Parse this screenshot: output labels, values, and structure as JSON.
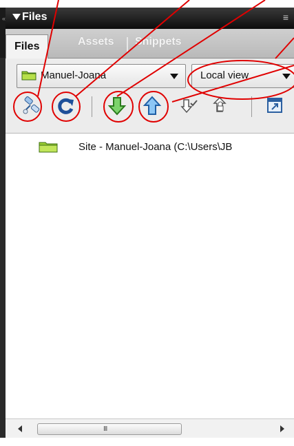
{
  "panel": {
    "title": "Files",
    "collapse_glyph": "«",
    "options_glyph": "≡"
  },
  "tabs": [
    {
      "label": "Files",
      "active": true
    },
    {
      "label": "Assets",
      "active": false
    },
    {
      "label": "Snippets",
      "active": false
    }
  ],
  "toolbar": {
    "site_select": {
      "value": "Manuel-Joana"
    },
    "view_select": {
      "value": "Local view"
    },
    "buttons": [
      {
        "name": "connect-icon"
      },
      {
        "name": "refresh-icon"
      },
      {
        "name": "get-files-icon"
      },
      {
        "name": "put-files-icon"
      },
      {
        "name": "check-out-icon"
      },
      {
        "name": "check-in-icon"
      },
      {
        "name": "expand-view-icon"
      }
    ]
  },
  "file_list": {
    "rows": [
      {
        "label": "Site - Manuel-Joana (C:\\Users\\JB"
      }
    ]
  },
  "scrollbar": {
    "grip": "III"
  },
  "annotation": {
    "color": "#e00000"
  }
}
